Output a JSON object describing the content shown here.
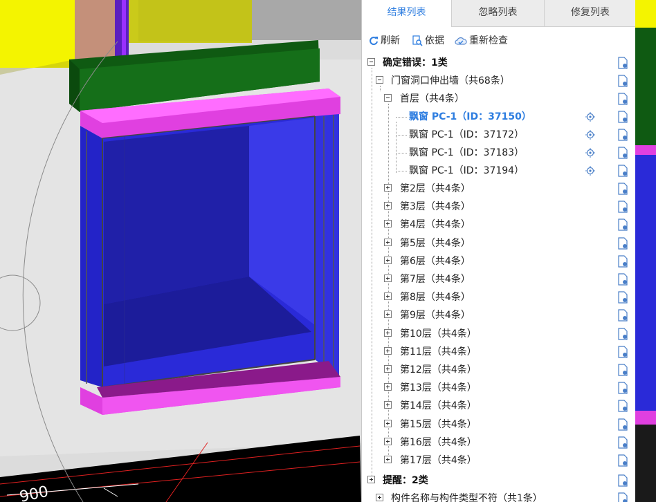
{
  "tabs": [
    {
      "label": "结果列表",
      "active": true
    },
    {
      "label": "忽略列表",
      "active": false
    },
    {
      "label": "修复列表",
      "active": false
    }
  ],
  "toolbar": {
    "refresh": "刷新",
    "basis": "依据",
    "recheck": "重新检查"
  },
  "tree": {
    "cat1": "确定错误：1类",
    "group1": "门窗洞口伸出墙（共68条）",
    "floor1": "首层（共4条）",
    "items": [
      "飘窗 PC-1（ID：37150）",
      "飘窗 PC-1（ID：37172）",
      "飘窗 PC-1（ID：37183）",
      "飘窗 PC-1（ID：37194）"
    ],
    "floors": [
      "第2层（共4条）",
      "第3层（共4条）",
      "第4层（共4条）",
      "第5层（共4条）",
      "第6层（共4条）",
      "第7层（共4条）",
      "第8层（共4条）",
      "第9层（共4条）",
      "第10层（共4条）",
      "第11层（共4条）",
      "第12层（共4条）",
      "第13层（共4条）",
      "第14层（共4条）",
      "第15层（共4条）",
      "第16层（共4条）",
      "第17层（共4条）"
    ],
    "cat2": "提醒：2类",
    "group2": "构件名称与构件类型不符（共1条）"
  },
  "viewport": {
    "dimension_label": "900"
  },
  "colors": {
    "accent": "#2d7de0",
    "magenta": "#e040e0",
    "glass_blue": "#2a2ad8",
    "roof_green": "#0f5a12",
    "wall_yellow": "#f4f400"
  }
}
